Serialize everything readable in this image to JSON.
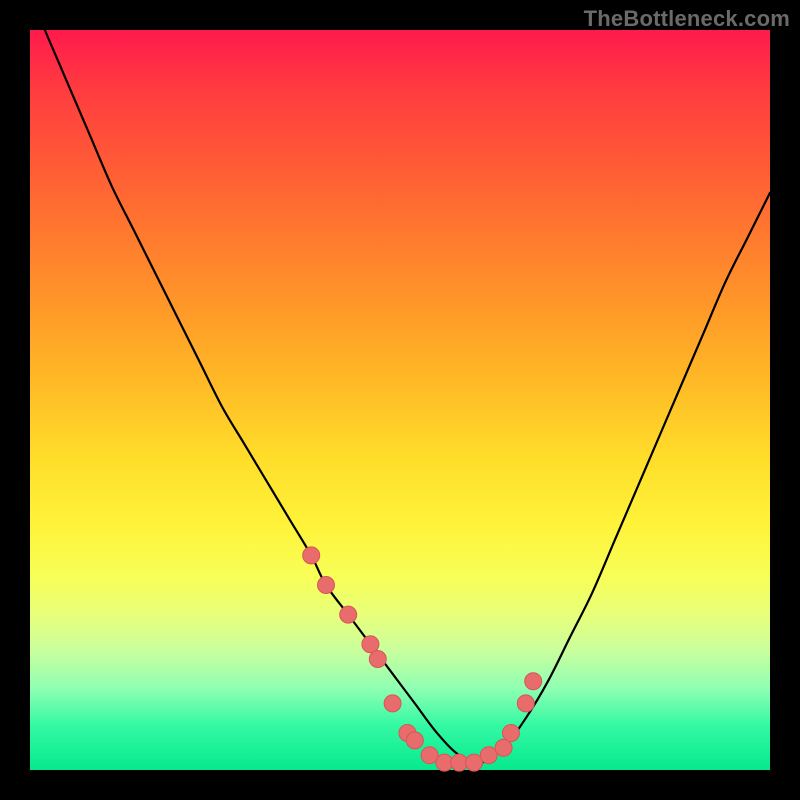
{
  "watermark": "TheBottleneck.com",
  "colors": {
    "gradient_top": "#ff1a4d",
    "gradient_mid_upper": "#ff9a28",
    "gradient_mid": "#fff33a",
    "gradient_lower": "#8effb2",
    "gradient_bottom": "#07e98e",
    "curve_stroke": "#000000",
    "marker_fill": "#e86c6c",
    "marker_stroke": "#d65656",
    "frame_border": "#000000"
  },
  "chart_data": {
    "type": "line",
    "title": "",
    "xlabel": "",
    "ylabel": "",
    "xlim": [
      0,
      100
    ],
    "ylim": [
      0,
      100
    ],
    "grid": false,
    "legend": false,
    "series": [
      {
        "name": "curve",
        "x": [
          2,
          5,
          8,
          11,
          14,
          17,
          20,
          23,
          26,
          29,
          32,
          35,
          38,
          40,
          43,
          46,
          49,
          52,
          55,
          58,
          61,
          64,
          67,
          70,
          73,
          76,
          79,
          82,
          85,
          88,
          91,
          94,
          97,
          100
        ],
        "y": [
          100,
          93,
          86,
          79,
          73,
          67,
          61,
          55,
          49,
          44,
          39,
          34,
          29,
          25,
          21,
          17,
          13,
          9,
          5,
          2,
          1,
          3,
          7,
          12,
          18,
          24,
          31,
          38,
          45,
          52,
          59,
          66,
          72,
          78
        ]
      }
    ],
    "markers": {
      "name": "highlighted-points",
      "x": [
        38,
        40,
        43,
        46,
        47,
        49,
        51,
        52,
        54,
        56,
        58,
        60,
        62,
        64,
        65,
        67,
        68
      ],
      "y": [
        29,
        25,
        21,
        17,
        15,
        9,
        5,
        4,
        2,
        1,
        1,
        1,
        2,
        3,
        5,
        9,
        12
      ]
    }
  }
}
